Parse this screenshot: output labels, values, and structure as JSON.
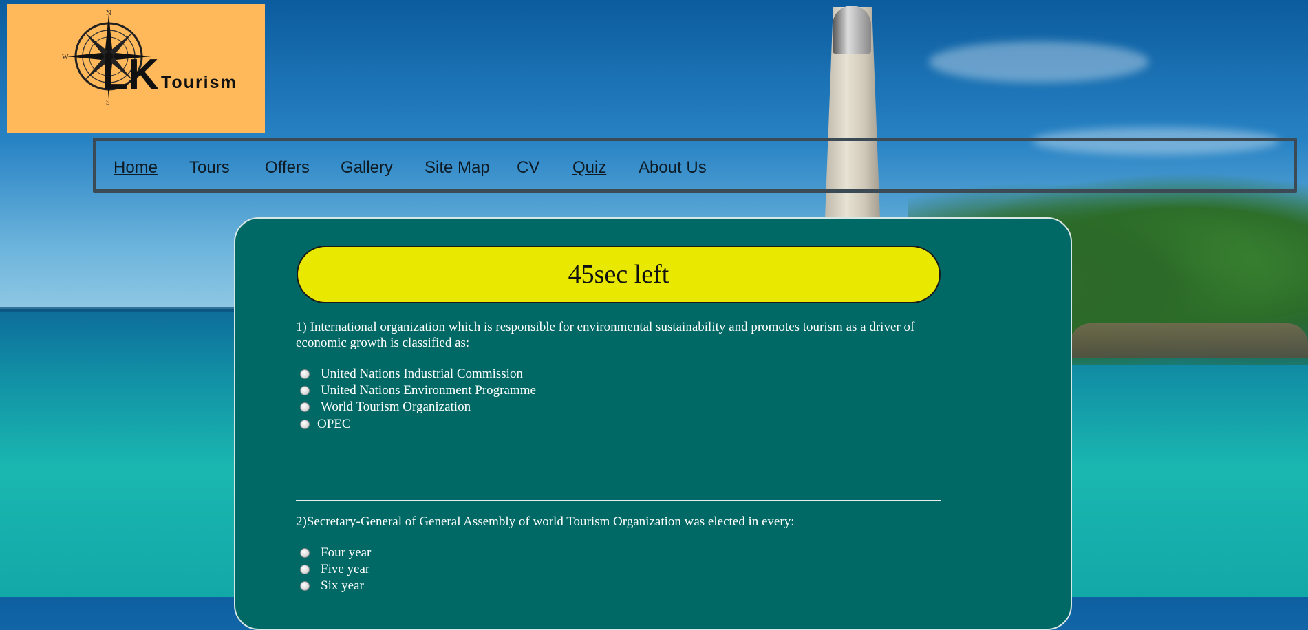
{
  "brand": {
    "logo_letters": "LK",
    "logo_word": "Tourism",
    "compass_points": [
      "N",
      "W",
      "S"
    ]
  },
  "nav": {
    "items": [
      {
        "label": "Home"
      },
      {
        "label": "Tours"
      },
      {
        "label": "Offers"
      },
      {
        "label": "Gallery"
      },
      {
        "label": "Site Map"
      },
      {
        "label": "CV"
      },
      {
        "label": "Quiz"
      },
      {
        "label": "About Us"
      }
    ]
  },
  "quiz": {
    "timer_text": "45sec left",
    "questions": [
      {
        "text": "1) International organization which is responsible for environmental sustainability and promotes tourism as a driver of economic growth is classified as:",
        "options": [
          "United Nations Industrial Commission",
          "United Nations Environment Programme",
          "World Tourism Organization",
          "OPEC"
        ]
      },
      {
        "text": "2)Secretary-General of General Assembly of world Tourism Organization was elected in every:",
        "options": [
          "Four year",
          "Five year",
          "Six year"
        ]
      }
    ]
  },
  "colors": {
    "quiz_panel": "#006965",
    "timer_bg": "#e8e800",
    "logo_bg": "#ffb85a"
  }
}
